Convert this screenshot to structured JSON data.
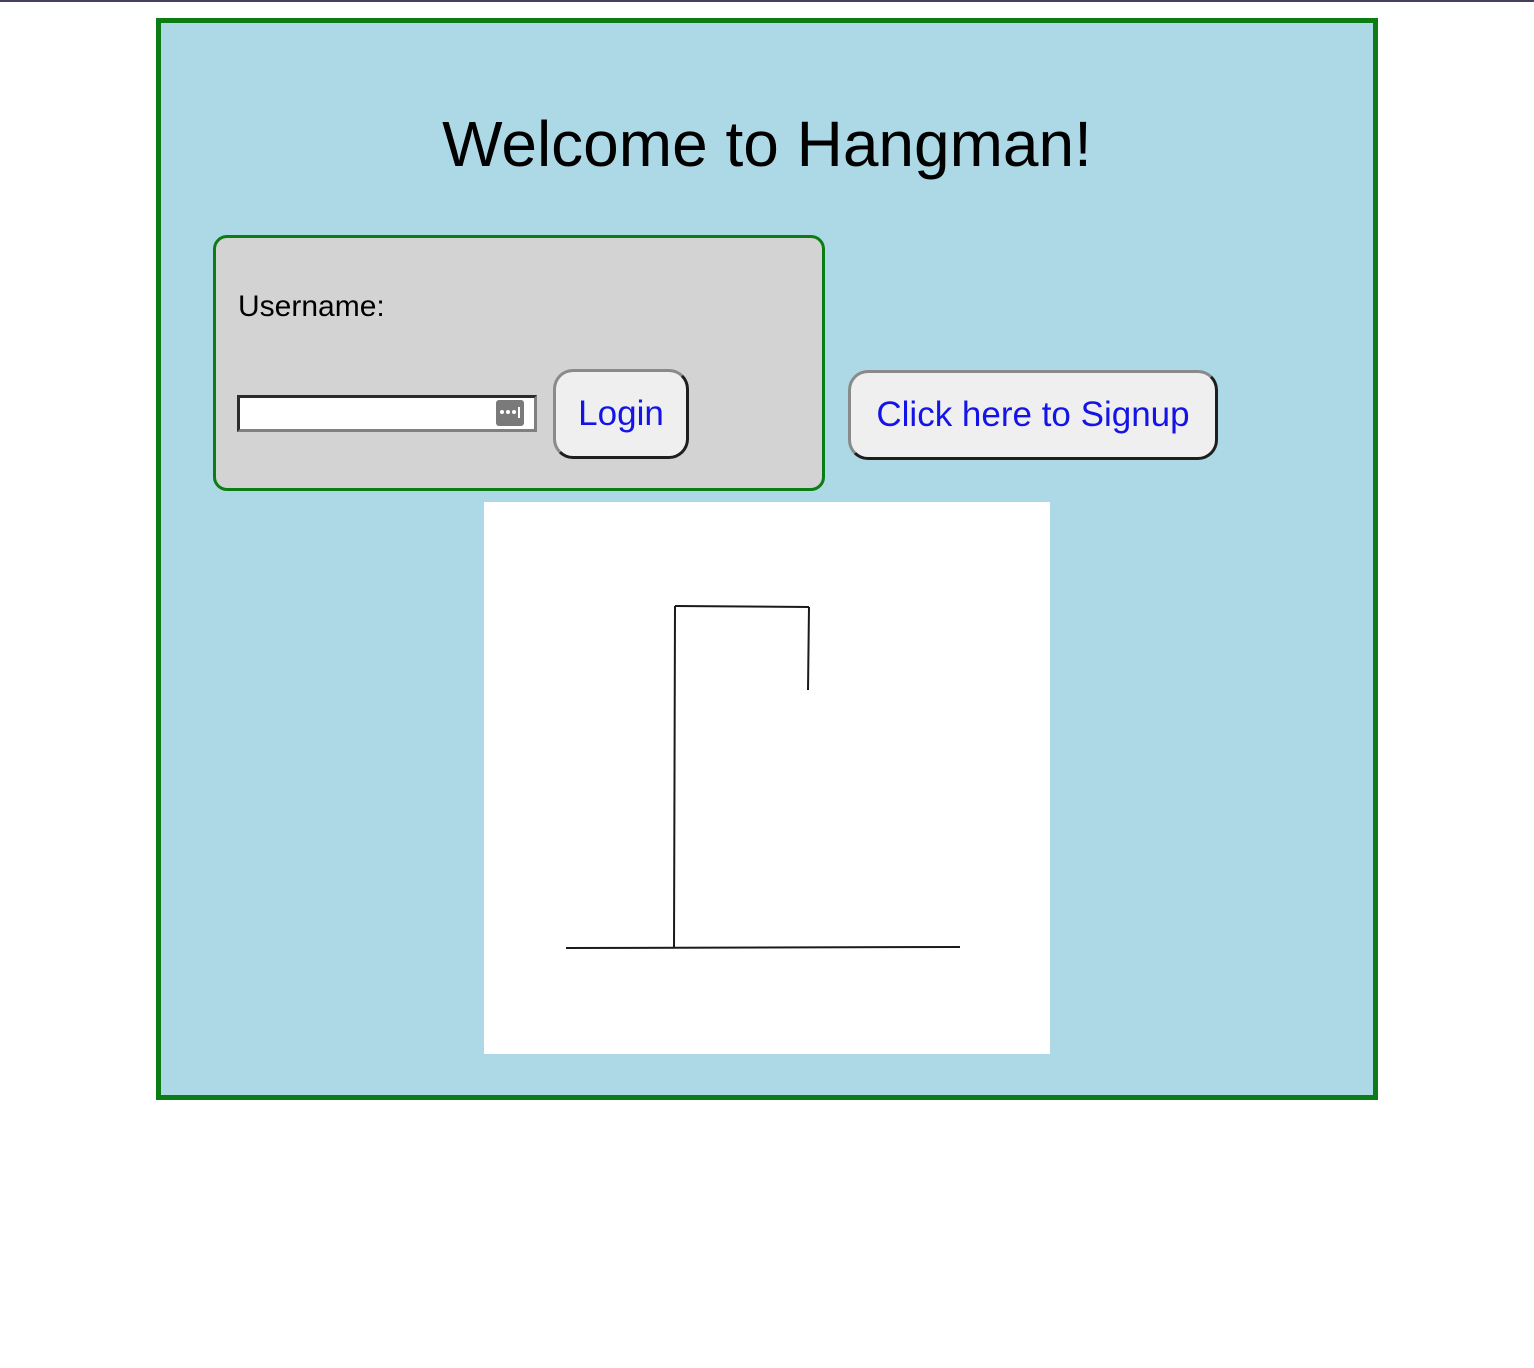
{
  "page": {
    "title": "Welcome to Hangman!"
  },
  "login": {
    "username_label": "Username:",
    "username_value": "",
    "login_button": "Login"
  },
  "signup": {
    "button_label": "Click here to Signup"
  },
  "hangman": {
    "stage": "gallows",
    "parts_drawn": [
      "base",
      "pole",
      "beam",
      "rope"
    ]
  },
  "colors": {
    "panel_background": "#add8e6",
    "panel_border": "#0b7d14",
    "login_box_background": "#d3d3d3",
    "button_text": "#1414e6",
    "button_background": "#efefef"
  }
}
